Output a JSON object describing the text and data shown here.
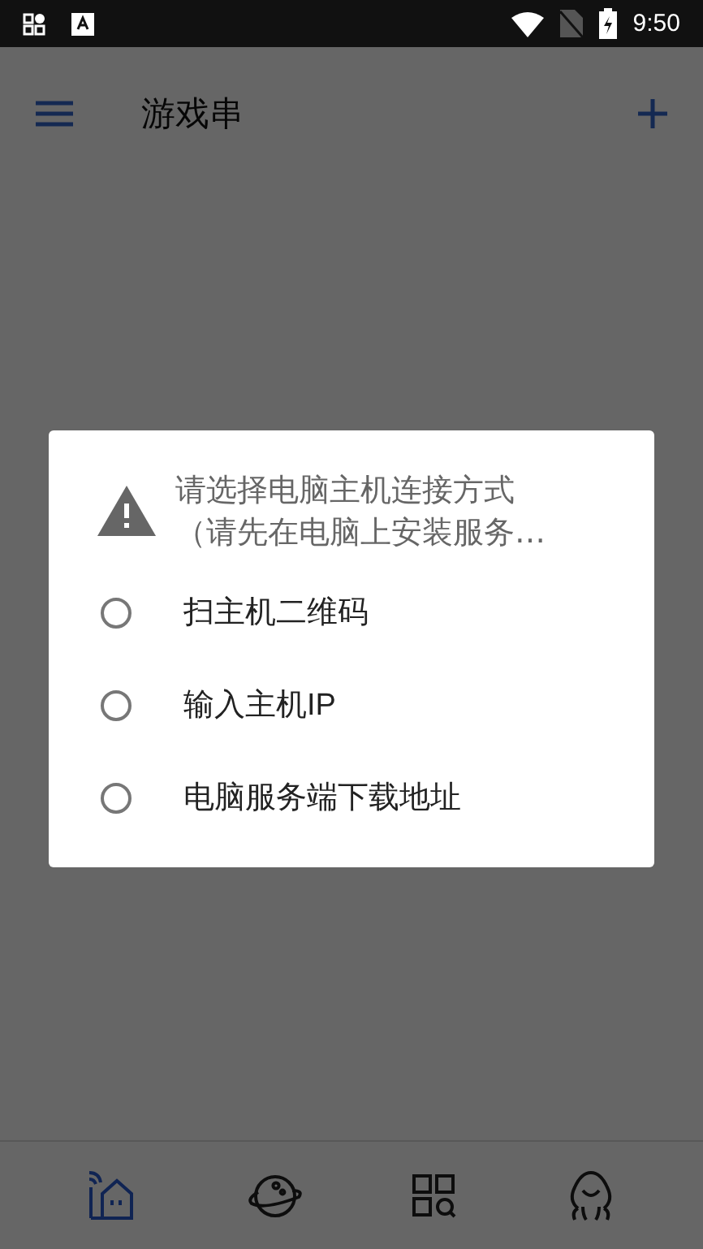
{
  "status_bar": {
    "time": "9:50"
  },
  "app_bar": {
    "title": "游戏串"
  },
  "dialog": {
    "message_lines": [
      "请选择电脑主机连接方式",
      "（请先在电脑上安装服务…"
    ],
    "options": [
      {
        "label": "扫主机二维码",
        "selected": false
      },
      {
        "label": "输入主机IP",
        "selected": false
      },
      {
        "label": "电脑服务端下载地址",
        "selected": false
      }
    ]
  },
  "bottom_nav": [
    {
      "kind": "home",
      "selected": true
    },
    {
      "kind": "planet",
      "selected": false
    },
    {
      "kind": "apps",
      "selected": false
    },
    {
      "kind": "profile",
      "selected": false
    }
  ]
}
